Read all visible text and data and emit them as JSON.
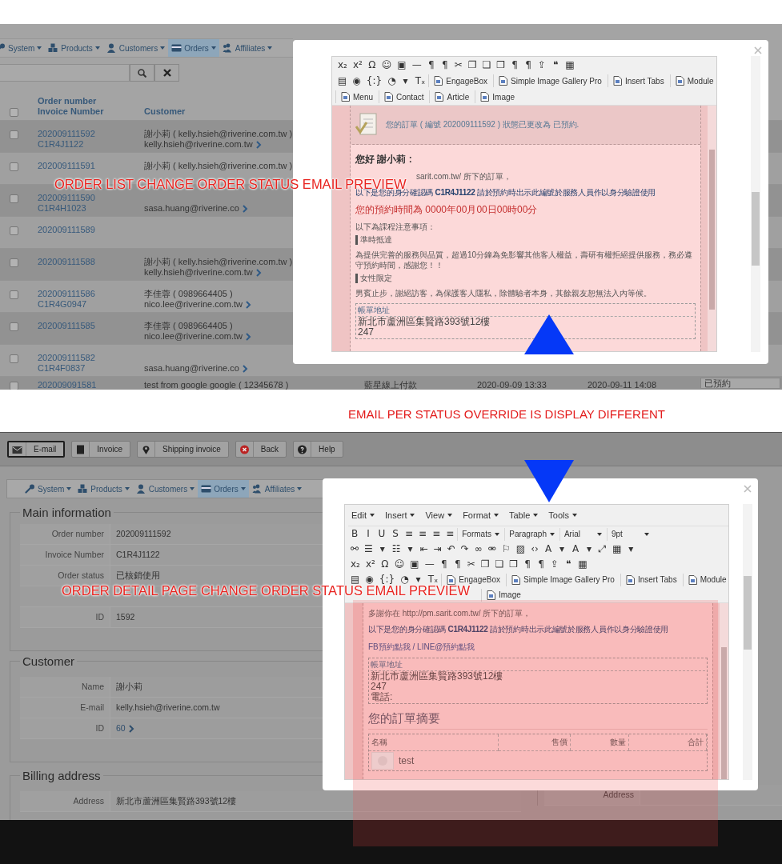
{
  "order_list_screen": {
    "nav": [
      {
        "label": "System",
        "selected": false
      },
      {
        "label": "Products",
        "selected": false
      },
      {
        "label": "Customers",
        "selected": false
      },
      {
        "label": "Orders",
        "selected": true
      },
      {
        "label": "Affiliates",
        "selected": false
      }
    ],
    "select_all": {
      "checked": false
    },
    "columns": [
      {
        "title": "Order number",
        "subtitle": "Invoice Number"
      },
      {
        "title": "Customer"
      }
    ],
    "rows": [
      {
        "order": "202009111592",
        "invoice": "C1R4J1122",
        "customer": "謝小莉 ( kelly.hsieh@riverine.com.tw )",
        "email": "kelly.hsieh@riverine.com.tw",
        "checked": false
      },
      {
        "order": "202009111591",
        "customer": "謝小莉 ( kelly.hsieh@riverine.com.tw )",
        "checked": false
      },
      {
        "order": "202009111590",
        "invoice": "C1R4H1023",
        "email": "sasa.huang@riverine.co",
        "checked": false
      },
      {
        "order": "202009111589",
        "checked": false
      },
      {
        "order": "202009111588",
        "customer": "謝小莉 ( kelly.hsieh@riverine.com.tw )",
        "email": "kelly.hsieh@riverine.com.tw",
        "checked": false
      },
      {
        "order": "202009111586",
        "invoice": "C1R4G0947",
        "customer": "李佳蓉 ( 0989664405 )",
        "email": "nico.lee@riverine.com.tw",
        "checked": false
      },
      {
        "order": "202009111585",
        "customer": "李佳蓉 ( 0989664405 )",
        "email": "nico.lee@riverine.com.tw",
        "checked": false
      },
      {
        "order": "202009111582",
        "invoice": "C1R4F0837",
        "email": "sasa.huang@riverine.co",
        "checked": false
      },
      {
        "order": "202009091581",
        "customer": "test from google google ( 12345678 )",
        "payment": "藍星線上付款",
        "created": "2020-09-09 13:33",
        "updated": "2020-09-11 14:08",
        "status": "已預約",
        "checked": false
      }
    ],
    "caption": "ORDER LIST CHANGE ORDER STATUS EMAIL PREVIEW",
    "email_preview": {
      "toolbar": [
        [
          {
            "kind": "glyph",
            "text": "x₂"
          },
          {
            "kind": "glyph",
            "text": "x²"
          },
          {
            "kind": "glyph",
            "text": "Ω"
          },
          {
            "kind": "glyph",
            "text": "☺"
          },
          {
            "kind": "glyph",
            "text": "▣"
          },
          {
            "kind": "glyph",
            "text": "—"
          },
          {
            "kind": "glyph",
            "text": "¶"
          },
          {
            "kind": "glyph",
            "text": "¶"
          },
          {
            "kind": "glyph",
            "text": "✂"
          },
          {
            "kind": "glyph",
            "text": "❐"
          },
          {
            "kind": "glyph",
            "text": "❏"
          },
          {
            "kind": "glyph",
            "text": "❒"
          },
          {
            "kind": "glyph",
            "text": "¶"
          },
          {
            "kind": "glyph",
            "text": "¶"
          },
          {
            "kind": "glyph",
            "text": "⇪"
          },
          {
            "kind": "glyph",
            "text": "❝"
          },
          {
            "kind": "glyph",
            "text": "▦"
          }
        ],
        [
          {
            "kind": "glyph",
            "text": "▤"
          },
          {
            "kind": "glyph",
            "text": "◉"
          },
          {
            "kind": "glyph",
            "text": "{:}"
          },
          {
            "kind": "glyph",
            "text": "◔"
          },
          {
            "kind": "glyph",
            "text": "▾"
          },
          {
            "kind": "glyph",
            "text": "Tₓ"
          },
          {
            "kind": "plugin",
            "label": "EngageBox"
          },
          {
            "kind": "plugin",
            "label": "Simple Image Gallery Pro"
          },
          {
            "kind": "plugin",
            "label": "Insert Tabs"
          },
          {
            "kind": "plugin",
            "label": "Module"
          }
        ],
        [
          {
            "kind": "plugin",
            "label": "Menu"
          },
          {
            "kind": "plugin",
            "label": "Contact"
          },
          {
            "kind": "plugin",
            "label": "Article"
          },
          {
            "kind": "plugin",
            "label": "Image"
          }
        ]
      ],
      "content": [
        {
          "kind": "notice",
          "text": "您的訂單 ( 編號 202009111592 ) 狀態已更改為 已預約."
        },
        {
          "kind": "greeting",
          "text": "您好 謝小莉 :"
        },
        {
          "kind": "partial",
          "text": "sarit.com.tw/ 所下的訂單，"
        },
        {
          "kind": "code",
          "text": "以下是您的身分確認碼 **C1R4J1122** 請於預約時出示此編號於服務人員作以身分驗證使用"
        },
        {
          "kind": "alert",
          "text": "您的預約時間為 0000年00月00日00時00分"
        },
        {
          "kind": "line",
          "text": "以下為課程注意事項："
        },
        {
          "kind": "topic",
          "text": "準時抵達"
        },
        {
          "kind": "line",
          "text": "為提供完善的服務與品質，超過10分鐘為免影響其他客人權益，壽研有權拒絕提供服務，務必遵守預約時間，感謝您！！"
        },
        {
          "kind": "topic",
          "text": "女性限定"
        },
        {
          "kind": "line",
          "text": "男賓止步，謝絕訪客，為保護客人隱私，除體驗者本身，其餘親友恕無法入內等候。"
        },
        {
          "kind": "address",
          "title": "帳單地址",
          "lines": [
            "新北市蘆洲區集賢路393號12樓",
            "247"
          ]
        }
      ]
    }
  },
  "comparison_note": "EMAIL PER STATUS OVERRIDE IS DISPLAY DIFFERENT",
  "order_detail_screen": {
    "actions": [
      {
        "label": "E-mail",
        "selected": true
      },
      {
        "label": "Invoice",
        "selected": false
      },
      {
        "label": "Shipping invoice",
        "selected": false
      },
      {
        "label": "Back",
        "selected": false
      },
      {
        "label": "Help",
        "selected": false
      }
    ],
    "nav": [
      {
        "label": "System",
        "selected": false
      },
      {
        "label": "Products",
        "selected": false
      },
      {
        "label": "Customers",
        "selected": false
      },
      {
        "label": "Orders",
        "selected": true
      },
      {
        "label": "Affiliates",
        "selected": false
      }
    ],
    "sections": [
      {
        "title": "Main information",
        "rows": [
          {
            "kind": "field",
            "label": "Order number",
            "value": "202009111592"
          },
          {
            "kind": "field",
            "label": "Invoice Number",
            "value": "C1R4J1122"
          },
          {
            "kind": "field",
            "label": "Order status",
            "value": "已核銷使用"
          },
          {
            "kind": "covered"
          },
          {
            "kind": "field",
            "label": "ID",
            "value": "1592"
          }
        ]
      },
      {
        "title": "Customer",
        "rows": [
          {
            "kind": "field",
            "label": "Name",
            "value": "謝小莉"
          },
          {
            "kind": "field",
            "label": "E-mail",
            "value": "kelly.hsieh@riverine.com.tw"
          },
          {
            "kind": "link",
            "label": "ID",
            "value": "60"
          }
        ]
      },
      {
        "title": "Billing address",
        "rows": [
          {
            "kind": "field",
            "label": "Address",
            "value": "新北市蘆洲區集賢路393號12樓"
          }
        ]
      }
    ],
    "side_rows": [
      {
        "label": "Address"
      }
    ],
    "caption": "ORDER DETAIL PAGE CHANGE ORDER STATUS EMAIL PREVIEW",
    "email_preview": {
      "menu": [
        "Edit",
        "Insert",
        "View",
        "Format",
        "Table",
        "Tools"
      ],
      "toolbar": [
        [
          {
            "kind": "glyph",
            "text": "B"
          },
          {
            "kind": "glyph",
            "text": "I"
          },
          {
            "kind": "glyph",
            "text": "U"
          },
          {
            "kind": "glyph",
            "text": "S"
          },
          {
            "kind": "glyph",
            "text": "≡"
          },
          {
            "kind": "glyph",
            "text": "≡"
          },
          {
            "kind": "glyph",
            "text": "≡"
          },
          {
            "kind": "glyph",
            "text": "≡"
          },
          {
            "kind": "dropdown",
            "label": "Formats"
          },
          {
            "kind": "dropdown",
            "label": "Paragraph"
          },
          {
            "kind": "dropdown",
            "label": "Arial"
          },
          {
            "kind": "dropdown",
            "label": "9pt"
          }
        ],
        [
          {
            "kind": "glyph",
            "text": "⚯"
          },
          {
            "kind": "glyph",
            "text": "☰"
          },
          {
            "kind": "glyph",
            "text": "▾"
          },
          {
            "kind": "glyph",
            "text": "☷"
          },
          {
            "kind": "glyph",
            "text": "▾"
          },
          {
            "kind": "glyph",
            "text": "⇤"
          },
          {
            "kind": "glyph",
            "text": "⇥"
          },
          {
            "kind": "glyph",
            "text": "↶"
          },
          {
            "kind": "glyph",
            "text": "↷"
          },
          {
            "kind": "glyph",
            "text": "∞"
          },
          {
            "kind": "glyph",
            "text": "⚮"
          },
          {
            "kind": "glyph",
            "text": "⚐"
          },
          {
            "kind": "glyph",
            "text": "▨"
          },
          {
            "kind": "glyph",
            "text": "‹›"
          },
          {
            "kind": "glyph",
            "text": "A"
          },
          {
            "kind": "glyph",
            "text": "▾"
          },
          {
            "kind": "glyph",
            "text": "A"
          },
          {
            "kind": "glyph",
            "text": "▾"
          },
          {
            "kind": "glyph",
            "text": "⤢"
          },
          {
            "kind": "glyph",
            "text": "▦"
          },
          {
            "kind": "glyph",
            "text": "▾"
          }
        ],
        [
          {
            "kind": "glyph",
            "text": "x₂"
          },
          {
            "kind": "glyph",
            "text": "x²"
          },
          {
            "kind": "glyph",
            "text": "Ω"
          },
          {
            "kind": "glyph",
            "text": "☺"
          },
          {
            "kind": "glyph",
            "text": "▣"
          },
          {
            "kind": "glyph",
            "text": "—"
          },
          {
            "kind": "glyph",
            "text": "¶"
          },
          {
            "kind": "glyph",
            "text": "¶"
          },
          {
            "kind": "glyph",
            "text": "✂"
          },
          {
            "kind": "glyph",
            "text": "❐"
          },
          {
            "kind": "glyph",
            "text": "❏"
          },
          {
            "kind": "glyph",
            "text": "❒"
          },
          {
            "kind": "glyph",
            "text": "¶"
          },
          {
            "kind": "glyph",
            "text": "¶"
          },
          {
            "kind": "glyph",
            "text": "⇪"
          },
          {
            "kind": "glyph",
            "text": "❝"
          },
          {
            "kind": "glyph",
            "text": "▦"
          }
        ],
        [
          {
            "kind": "glyph",
            "text": "▤"
          },
          {
            "kind": "glyph",
            "text": "◉"
          },
          {
            "kind": "glyph",
            "text": "{:}"
          },
          {
            "kind": "glyph",
            "text": "◔"
          },
          {
            "kind": "glyph",
            "text": "▾"
          },
          {
            "kind": "glyph",
            "text": "Tₓ"
          },
          {
            "kind": "plugin",
            "label": "EngageBox"
          },
          {
            "kind": "plugin",
            "label": "Simple Image Gallery Pro"
          },
          {
            "kind": "plugin",
            "label": "Insert Tabs"
          },
          {
            "kind": "plugin",
            "label": "Module"
          }
        ],
        [
          {
            "kind": "covered"
          },
          {
            "kind": "plugin",
            "label": "Image"
          }
        ]
      ],
      "content": [
        {
          "kind": "line",
          "text": "多謝你在 http://pm.sarit.com.tw/ 所下的訂單，"
        },
        {
          "kind": "code",
          "text": "以下是您的身分確認碼 **C1R4J1122** 請於預約時出示此編號於服務人員作以身分驗證使用"
        },
        {
          "kind": "link",
          "text": "FB預約點我 / LINE@預約點我"
        },
        {
          "kind": "address",
          "title": "帳單地址",
          "lines": [
            "新北市蘆洲區集賢路393號12樓",
            "247",
            "電話:"
          ]
        },
        {
          "kind": "summary",
          "text": "您的訂單摘要"
        },
        {
          "kind": "table",
          "columns": [
            "名稱",
            "售價",
            "數量",
            "合計"
          ],
          "rows": [
            {
              "name": "test"
            }
          ]
        }
      ]
    }
  }
}
